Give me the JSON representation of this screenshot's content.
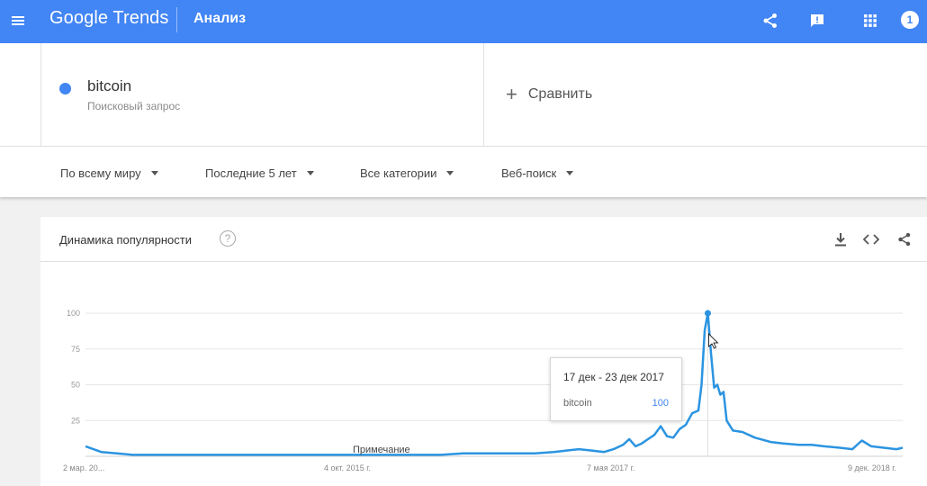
{
  "header": {
    "brand": "Google Trends",
    "section_title": "Анализ",
    "avatar_initial": "1",
    "icons": [
      "menu-icon",
      "share-icon",
      "feedback-icon",
      "apps-grid-icon"
    ]
  },
  "term": {
    "name": "bitcoin",
    "type": "Поисковый запрос",
    "color": "#4285f4"
  },
  "compare_label": "Сравнить",
  "filters": {
    "region": "По всему миру",
    "period": "Последние 5 лет",
    "category": "Все категории",
    "search_type": "Веб-поиск"
  },
  "chart_card": {
    "title": "Динамика популярности",
    "help": "?",
    "note_label": "Примечание",
    "icons": [
      "download-icon",
      "embed-code-icon",
      "share-icon"
    ]
  },
  "tooltip": {
    "date_range": "17 дек - 23 дек 2017",
    "term": "bitcoin",
    "value": "100"
  },
  "chart_data": {
    "type": "line",
    "title": "Динамика популярности",
    "xlabel": "",
    "ylabel": "",
    "ylim": [
      0,
      100
    ],
    "yticks": [
      25,
      50,
      75,
      100
    ],
    "x_tick_labels": [
      "2 мар. 20...",
      "4 окт. 2015 г.",
      "7 мая 2017 г.",
      "9 дек. 2018 г."
    ],
    "x_range": [
      "2014-03-02",
      "2019-02-24"
    ],
    "grid": true,
    "series": [
      {
        "name": "bitcoin",
        "color": "#2b94e1",
        "points": [
          [
            "2014-03-02",
            7
          ],
          [
            "2014-04-06",
            3
          ],
          [
            "2014-05-11",
            2
          ],
          [
            "2014-06-15",
            1
          ],
          [
            "2014-07-20",
            1
          ],
          [
            "2014-09-07",
            1
          ],
          [
            "2014-11-02",
            1
          ],
          [
            "2015-01-11",
            1
          ],
          [
            "2015-03-01",
            1
          ],
          [
            "2015-05-03",
            1
          ],
          [
            "2015-07-05",
            1
          ],
          [
            "2015-09-06",
            1
          ],
          [
            "2015-11-01",
            1
          ],
          [
            "2016-01-03",
            1
          ],
          [
            "2016-03-06",
            1
          ],
          [
            "2016-05-01",
            1
          ],
          [
            "2016-06-19",
            2
          ],
          [
            "2016-08-07",
            2
          ],
          [
            "2016-10-02",
            2
          ],
          [
            "2016-11-27",
            2
          ],
          [
            "2017-01-08",
            3
          ],
          [
            "2017-02-05",
            4
          ],
          [
            "2017-03-05",
            5
          ],
          [
            "2017-04-02",
            4
          ],
          [
            "2017-04-30",
            3
          ],
          [
            "2017-05-21",
            5
          ],
          [
            "2017-06-11",
            8
          ],
          [
            "2017-06-25",
            12
          ],
          [
            "2017-07-09",
            7
          ],
          [
            "2017-07-23",
            9
          ],
          [
            "2017-08-06",
            12
          ],
          [
            "2017-08-20",
            15
          ],
          [
            "2017-09-03",
            21
          ],
          [
            "2017-09-17",
            14
          ],
          [
            "2017-10-01",
            13
          ],
          [
            "2017-10-15",
            19
          ],
          [
            "2017-10-29",
            22
          ],
          [
            "2017-11-12",
            30
          ],
          [
            "2017-11-26",
            32
          ],
          [
            "2017-12-03",
            50
          ],
          [
            "2017-12-10",
            88
          ],
          [
            "2017-12-17",
            100
          ],
          [
            "2017-12-24",
            72
          ],
          [
            "2017-12-31",
            48
          ],
          [
            "2018-01-07",
            50
          ],
          [
            "2018-01-14",
            43
          ],
          [
            "2018-01-21",
            45
          ],
          [
            "2018-01-28",
            25
          ],
          [
            "2018-02-11",
            18
          ],
          [
            "2018-03-04",
            17
          ],
          [
            "2018-04-01",
            13
          ],
          [
            "2018-05-06",
            10
          ],
          [
            "2018-06-03",
            9
          ],
          [
            "2018-07-08",
            8
          ],
          [
            "2018-08-05",
            8
          ],
          [
            "2018-09-02",
            7
          ],
          [
            "2018-10-07",
            6
          ],
          [
            "2018-11-04",
            5
          ],
          [
            "2018-11-25",
            11
          ],
          [
            "2018-12-16",
            7
          ],
          [
            "2019-01-13",
            6
          ],
          [
            "2019-02-10",
            5
          ],
          [
            "2019-02-24",
            6
          ]
        ]
      }
    ],
    "highlight": {
      "x": "2017-12-17",
      "y": 100
    }
  }
}
